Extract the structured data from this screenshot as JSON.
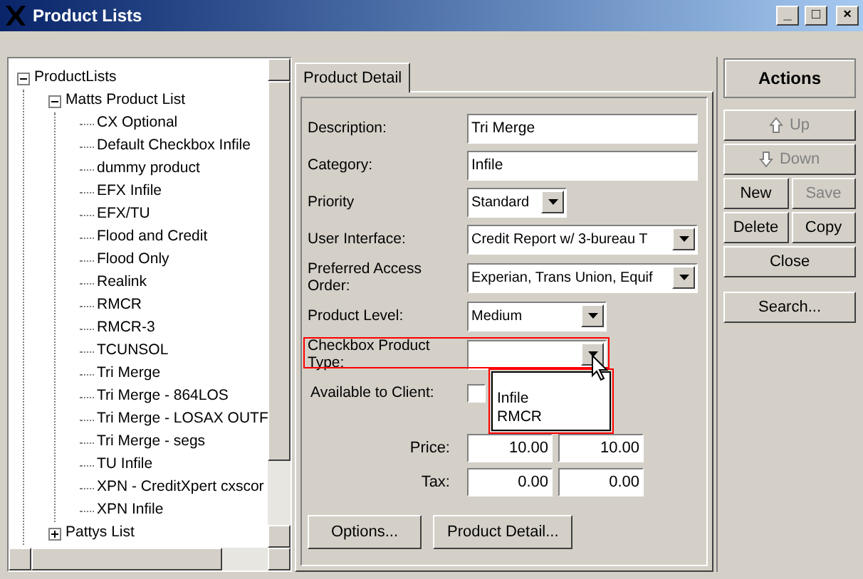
{
  "window": {
    "title": "Product Lists",
    "controls": [
      "_",
      "□",
      "×"
    ]
  },
  "tree": [
    {
      "label": "ProductLists",
      "expanded": true,
      "children": [
        {
          "label": "Matts Product List",
          "expanded": true,
          "children": [
            {
              "label": "CX Optional"
            },
            {
              "label": "Default Checkbox Infile"
            },
            {
              "label": "dummy product"
            },
            {
              "label": "EFX Infile"
            },
            {
              "label": "EFX/TU"
            },
            {
              "label": "Flood and Credit"
            },
            {
              "label": "Flood Only"
            },
            {
              "label": "Realink"
            },
            {
              "label": "RMCR"
            },
            {
              "label": "RMCR-3"
            },
            {
              "label": "TCUNSOL"
            },
            {
              "label": "Tri Merge"
            },
            {
              "label": "Tri Merge - 864LOS"
            },
            {
              "label": "Tri Merge - LOSAX OUTF"
            },
            {
              "label": "Tri Merge - segs"
            },
            {
              "label": "TU Infile"
            },
            {
              "label": "XPN - CreditXpert cxscor"
            },
            {
              "label": "XPN Infile"
            }
          ]
        },
        {
          "label": "Pattys List",
          "expanded": false
        }
      ]
    }
  ],
  "tabs": [
    {
      "label": "Product Detail",
      "selected": true
    }
  ],
  "form": [
    {
      "kind": "text",
      "label": "Description:",
      "value": "Tri Merge"
    },
    {
      "kind": "text",
      "label": "Category:",
      "value": "Infile"
    },
    {
      "kind": "select",
      "label": "Priority",
      "value": "Standard"
    },
    {
      "kind": "select",
      "label": "User Interface:",
      "value": "Credit Report w/ 3-bureau T"
    },
    {
      "kind": "select",
      "label": "Preferred Access Order:",
      "value": "Experian, Trans Union, Equif"
    },
    {
      "kind": "select",
      "label": "Product Level:",
      "value": "Medium"
    },
    {
      "kind": "select",
      "label": "Checkbox Product Type:",
      "highlighted": true,
      "open": true,
      "options": [
        "Infile",
        "RMCR"
      ]
    },
    {
      "kind": "checkbox",
      "label": "Available to Client:",
      "checked": false
    }
  ],
  "price_table": {
    "rows": [
      {
        "label": "Price:",
        "values": [
          "10.00",
          "10.00"
        ]
      },
      {
        "label": "Tax:",
        "values": [
          "0.00",
          "0.00"
        ]
      }
    ]
  },
  "bottom_buttons": [
    "Options...",
    "Product Detail..."
  ],
  "actions": {
    "title": "Actions",
    "buttons": [
      {
        "kind": "arrow-up",
        "label": "Up",
        "disabled": true
      },
      {
        "kind": "arrow-down",
        "label": "Down",
        "disabled": true
      },
      {
        "kind": "pair",
        "items": [
          {
            "label": "New",
            "disabled": false
          },
          {
            "label": "Save",
            "disabled": true
          }
        ]
      },
      {
        "kind": "pair",
        "items": [
          {
            "label": "Delete",
            "disabled": false
          },
          {
            "label": "Copy",
            "disabled": false
          }
        ]
      },
      {
        "kind": "plain",
        "label": "Close",
        "disabled": false
      },
      {
        "kind": "gap"
      },
      {
        "kind": "plain",
        "label": "Search...",
        "disabled": false
      }
    ]
  }
}
